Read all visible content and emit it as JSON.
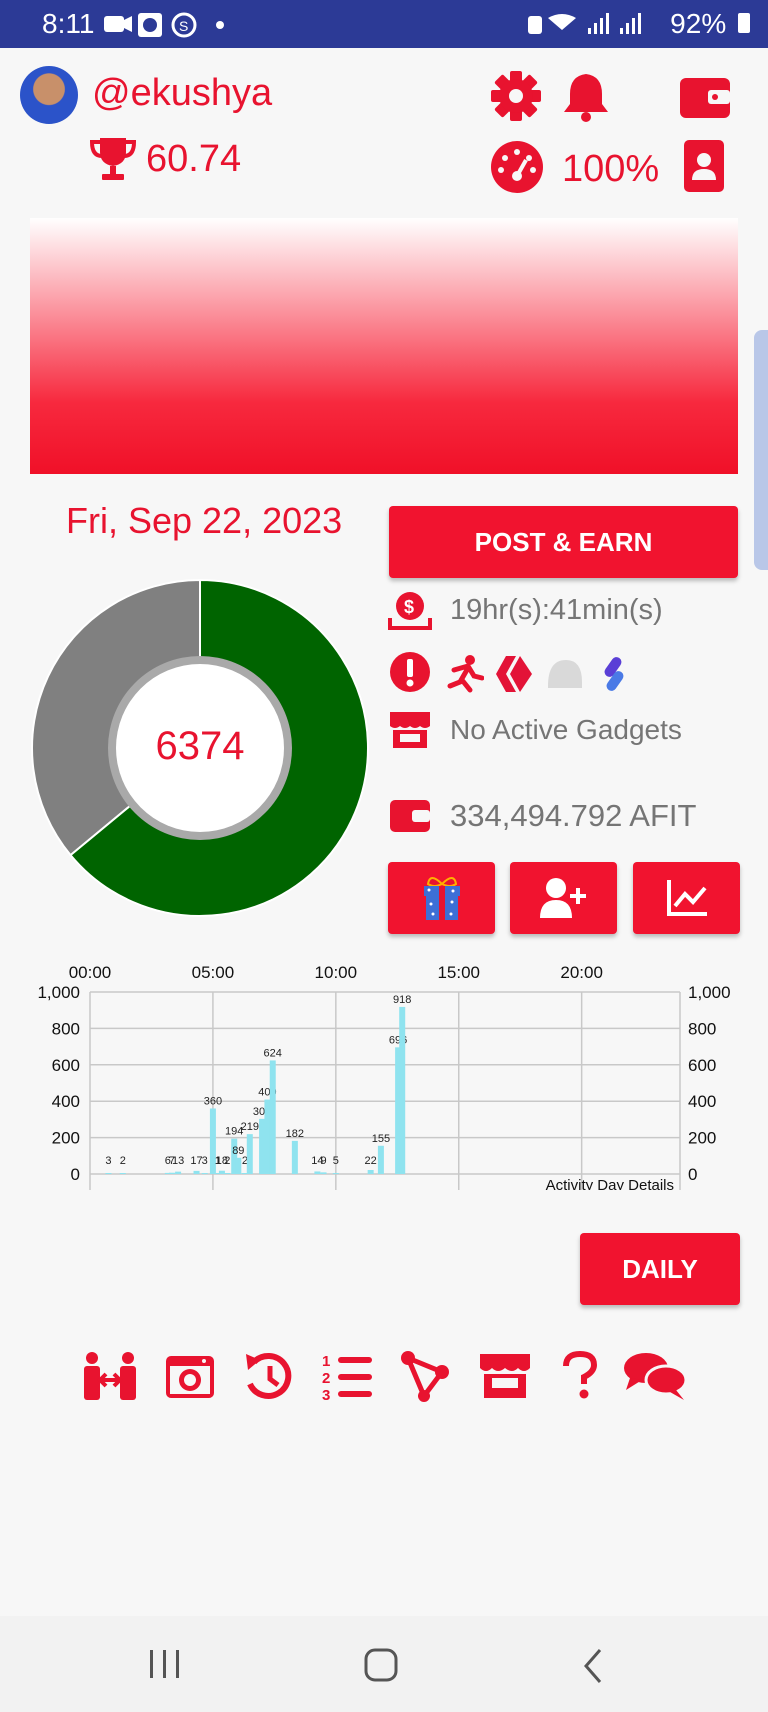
{
  "status_bar": {
    "time": "8:11",
    "battery": "92%",
    "background": "#2c3a96"
  },
  "profile": {
    "username": "@ekushya",
    "score": "60.74",
    "power_percent": "100%"
  },
  "date": "Fri, Sep 22, 2023",
  "post_earn_label": "POST & EARN",
  "timer": "19hr(s):41min(s)",
  "gadgets": "No Active Gadgets",
  "balance": "334,494.792 AFIT",
  "donut": {
    "center_value": "6374",
    "progress_fraction": 0.64,
    "progress_color": "#006400",
    "remainder_color": "#808080"
  },
  "daily_button": "DAILY",
  "accent_color": "#f1132f",
  "chart_data": {
    "type": "bar",
    "x_ticks": [
      "00:00",
      "05:00",
      "10:00",
      "15:00",
      "20:00"
    ],
    "y_ticks": [
      "1,000",
      "800",
      "600",
      "400",
      "200",
      "0"
    ],
    "ylim": [
      0,
      1000
    ],
    "xlim_minutes": [
      0,
      1440
    ],
    "annotation": "Activity Day Details",
    "bar_color": "#8fe3ef",
    "points": [
      {
        "minute": 45,
        "value": 3
      },
      {
        "minute": 80,
        "value": 2
      },
      {
        "minute": 190,
        "value": 6
      },
      {
        "minute": 200,
        "value": 7
      },
      {
        "minute": 215,
        "value": 13
      },
      {
        "minute": 260,
        "value": 17
      },
      {
        "minute": 280,
        "value": 3
      },
      {
        "minute": 300,
        "value": 360
      },
      {
        "minute": 312,
        "value": 1
      },
      {
        "minute": 322,
        "value": 18
      },
      {
        "minute": 335,
        "value": 2
      },
      {
        "minute": 352,
        "value": 194
      },
      {
        "minute": 362,
        "value": 89
      },
      {
        "minute": 378,
        "value": 2
      },
      {
        "minute": 390,
        "value": 219
      },
      {
        "minute": 420,
        "value": 303
      },
      {
        "minute": 433,
        "value": 409
      },
      {
        "minute": 446,
        "value": 624
      },
      {
        "minute": 500,
        "value": 182
      },
      {
        "minute": 555,
        "value": 14
      },
      {
        "minute": 570,
        "value": 9
      },
      {
        "minute": 600,
        "value": 5
      },
      {
        "minute": 685,
        "value": 22
      },
      {
        "minute": 710,
        "value": 155
      },
      {
        "minute": 752,
        "value": 696
      },
      {
        "minute": 762,
        "value": 918
      }
    ]
  },
  "icons": {
    "settings": "gear-icon",
    "notifications": "bell-icon",
    "wallet": "wallet-icon",
    "speed": "speedometer-icon",
    "profile_card": "id-badge-icon",
    "timer": "money-timer-icon",
    "alert": "alert-icon",
    "store": "store-icon",
    "gift": "gift-icon",
    "add_user": "add-user-icon",
    "stats": "line-chart-icon"
  },
  "bottom_icons": [
    "exercise-icon",
    "camera-icon",
    "history-icon",
    "ranking-list-icon",
    "share-icon",
    "shop-icon",
    "help-icon",
    "chat-icon"
  ],
  "android_nav": [
    "recent-apps-icon",
    "home-icon",
    "back-icon"
  ]
}
